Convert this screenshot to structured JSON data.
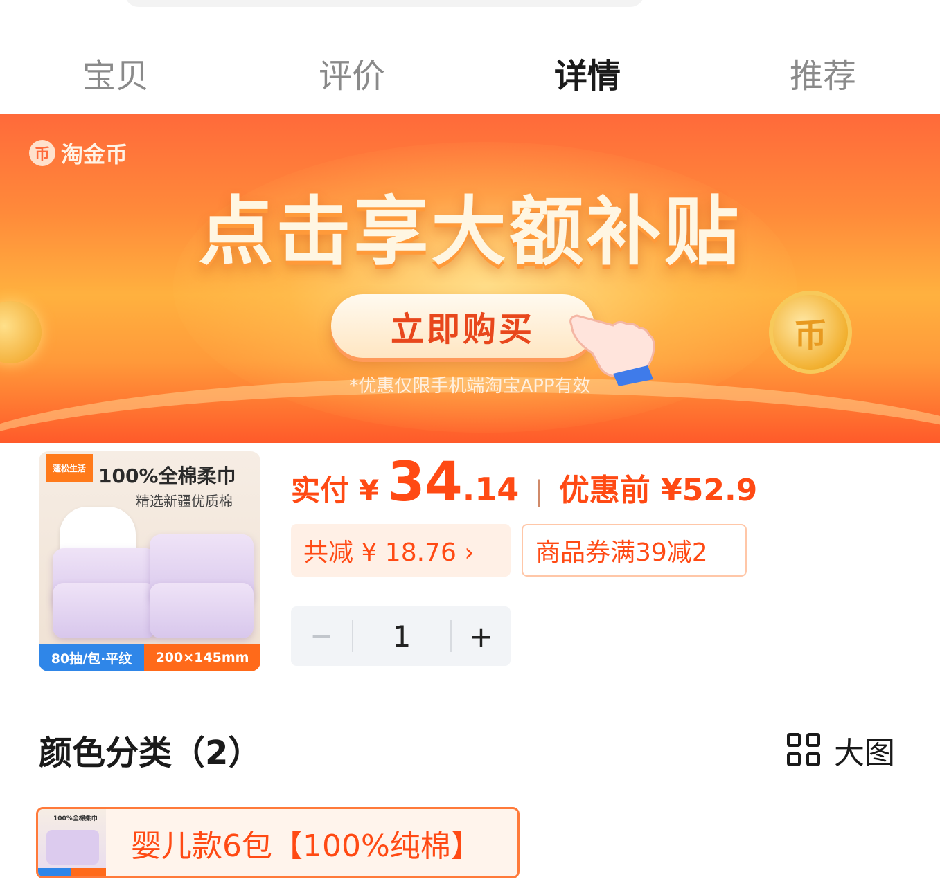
{
  "tabs": [
    {
      "label": "宝贝",
      "active": false
    },
    {
      "label": "评价",
      "active": false
    },
    {
      "label": "详情",
      "active": true
    },
    {
      "label": "推荐",
      "active": false
    }
  ],
  "banner": {
    "brand": "淘金币",
    "brand_icon": "coin-icon",
    "headline": "点击享大额补贴",
    "button": "立即购买",
    "disclaimer": "*优惠仅限手机端淘宝APP有效"
  },
  "product": {
    "image_title": "100%全棉柔巾",
    "image_subtitle": "精选新疆优质棉",
    "image_badge_left": "80抽/包·平纹",
    "image_badge_right": "200×145mm",
    "price_label": "实付",
    "currency": "¥",
    "price_int": "34",
    "price_dec": ".14",
    "separator": "|",
    "original_price": "优惠前 ¥52.9",
    "savings": "共减 ¥ 18.76 ›",
    "coupon": "商品券满39减2",
    "quantity": "1",
    "minus": "−",
    "plus": "+"
  },
  "color_section": {
    "title": "颜色分类（2）",
    "big_view": "大图",
    "variant_label": "婴儿款6包【100%纯棉】"
  },
  "colors": {
    "accent": "#ff4a14",
    "active_tab": "#1a1a1a",
    "inactive_tab": "#8a8a8a"
  }
}
